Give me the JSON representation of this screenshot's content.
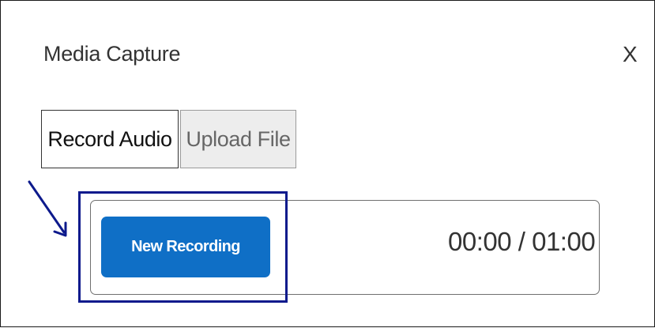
{
  "dialog": {
    "title": "Media Capture",
    "close_glyph": "X",
    "close_icon": "close-icon"
  },
  "tabs": [
    {
      "label": "Record Audio",
      "selected": true
    },
    {
      "label": "Upload File",
      "selected": false
    }
  ],
  "recorder": {
    "new_recording_label": "New Recording",
    "timer": "00:00 / 01:00",
    "button_color": "#0f6fc6"
  },
  "annotation": {
    "arrow_icon": "arrow-icon",
    "highlight_color": "#0d1a8c"
  }
}
